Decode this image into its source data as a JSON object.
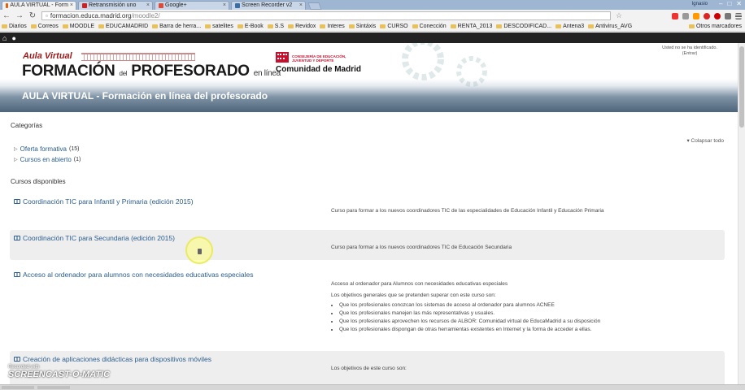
{
  "browser": {
    "tabs": [
      {
        "label": "AULA VIRTUAL - Form",
        "color": "#e06010",
        "active": true
      },
      {
        "label": "Retransmisión uno",
        "color": "#cc2222",
        "active": false
      },
      {
        "label": "Google+",
        "color": "#dd4b39",
        "active": false
      },
      {
        "label": "Screen Recorder v2",
        "color": "#3a6ea5",
        "active": false
      }
    ],
    "user": "Ignasio",
    "url_host": "formacion.educa.madrid.org",
    "url_path": "/moodle2/",
    "bookmarks": [
      "Diarios",
      "Correos",
      "MOODLE",
      "EDUCAMADRID",
      "Barra de herra...",
      "satelites",
      "E-Book",
      "S.S",
      "Revidox",
      "Interes",
      "Sintáxis",
      "CURSO",
      "Conección",
      "RENTA_2013",
      "DESCODIFICAD...",
      "Antena3",
      "Antivirus_AVG"
    ],
    "bookmarks_other": "Otros marcadores"
  },
  "header": {
    "logo_line1": "Aula Virtual",
    "logo_formacion": "FORMACIÓN",
    "logo_del": "del",
    "logo_profesorado": "PROFESORADO",
    "logo_enlinea": "en línea",
    "cm_small": "CONSEJERÍA DE EDUCACIÓN, JUVENTUD Y DEPORTE",
    "cm_big": "Comunidad de Madrid",
    "login_line1": "Usted no se ha identificado.",
    "login_line2": "(Entrar)",
    "site_title": "AULA VIRTUAL - Formación en línea del profesorado"
  },
  "categories": {
    "title": "Categorías",
    "collapse_all": "Colapsar todo",
    "items": [
      {
        "label": "Oferta formativa",
        "count": "(15)"
      },
      {
        "label": "Cursos en abierto",
        "count": "(1)"
      }
    ]
  },
  "courses": {
    "title": "Cursos disponibles",
    "items": [
      {
        "title": "Coordinación TIC para Infantil y Primaria (edición 2015)",
        "summary": "Curso para formar a los nuevos coordinadores TIC de las especialidades de Educación Infantil y Educación Primaria"
      },
      {
        "title": "Coordinación TIC para Secundaria (edición 2015)",
        "summary": "Curso para formar a los nuevos coordinadores TIC de Educación Secundaria"
      },
      {
        "title": "Acceso al ordenador para alumnos con necesidades educativas especiales",
        "summary": "Acceso al ordenador para Alumnos con necesidades educativas especiales",
        "summary2": "Los objetivos generales que se pretenden superar con este curso son:",
        "bullets": [
          "Que los profesionales conozcan los sistemas de acceso al ordenador para alumnos ACNEE",
          "Que los profesionales manejen las más representativas y usuales.",
          "Que los profesionales aprovechen los recursos de ALBOR: Comunidad virtual de EducaMadrid a su disposición",
          "Que los profesionales dispongan de otras herramientas existentes en Internet y la forma de acceder a ellas."
        ]
      },
      {
        "title": "Creación de aplicaciones didácticas para dispositivos móviles",
        "summary": "Los objetivos de este curso son:"
      }
    ]
  },
  "watermark": {
    "small": "Recorded with",
    "big": "SCREENCAST-O-MATIC"
  }
}
